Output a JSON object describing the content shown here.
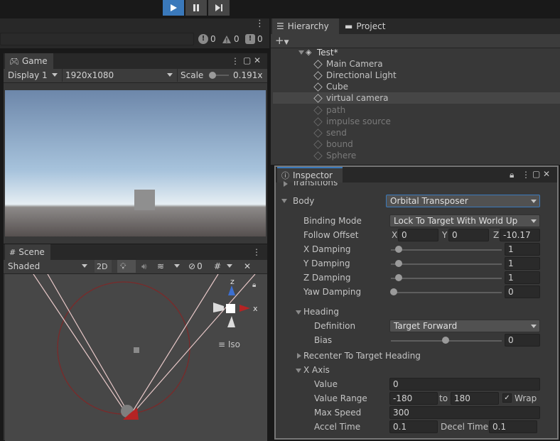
{
  "toolbar": {
    "play_icon": "play-icon",
    "pause_icon": "pause-icon",
    "step_icon": "step-icon"
  },
  "console": {
    "error_count": "0",
    "warning_count": "0",
    "info_count": "0"
  },
  "game": {
    "tab_label": "Game",
    "display": "Display 1",
    "resolution": "1920x1080",
    "scale_label": "Scale",
    "scale_value": "0.191x"
  },
  "scene": {
    "tab_label": "Scene",
    "shading": "Shaded",
    "mode_2d": "2D",
    "hidden_count": "0",
    "gizmo_axis_z": "z",
    "gizmo_axis_x": "x",
    "projection": "Iso"
  },
  "hierarchy": {
    "tab_label": "Hierarchy",
    "project_tab_label": "Project",
    "add_label": "+",
    "scene_name": "Test*",
    "items": [
      {
        "label": "Main Camera",
        "active": true
      },
      {
        "label": "Directional Light",
        "active": true
      },
      {
        "label": "Cube",
        "active": true
      },
      {
        "label": "virtual camera",
        "active": true,
        "selected": true
      },
      {
        "label": "path",
        "active": false
      },
      {
        "label": "impulse source",
        "active": false
      },
      {
        "label": "send",
        "active": false
      },
      {
        "label": "bound",
        "active": false
      },
      {
        "label": "Sphere",
        "active": false
      }
    ]
  },
  "inspector": {
    "tab_label": "Inspector",
    "transitions_label": "Transitions",
    "body_label": "Body",
    "body_value": "Orbital Transposer",
    "binding_mode_label": "Binding Mode",
    "binding_mode_value": "Lock To Target With World Up",
    "follow_offset_label": "Follow Offset",
    "follow_offset": {
      "x_label": "X",
      "x": "0",
      "y_label": "Y",
      "y": "0",
      "z_label": "Z",
      "z": "-10.17"
    },
    "x_damping_label": "X Damping",
    "x_damping": "1",
    "y_damping_label": "Y Damping",
    "y_damping": "1",
    "z_damping_label": "Z Damping",
    "z_damping": "1",
    "yaw_damping_label": "Yaw Damping",
    "yaw_damping": "0",
    "heading_label": "Heading",
    "definition_label": "Definition",
    "definition_value": "Target Forward",
    "bias_label": "Bias",
    "bias_value": "0",
    "recenter_label": "Recenter To Target Heading",
    "x_axis_label": "X Axis",
    "value_label": "Value",
    "value": "0",
    "value_range_label": "Value Range",
    "range_min": "-180",
    "range_to": "to",
    "range_max": "180",
    "wrap_label": "Wrap",
    "max_speed_label": "Max Speed",
    "max_speed": "300",
    "accel_time_label": "Accel Time",
    "accel_time": "0.1",
    "decel_time_label": "Decel Time",
    "decel_time": "0.1"
  },
  "colors": {
    "accent": "#3a79bb",
    "background": "#383838",
    "field": "#2a2a2a",
    "gizmo_red": "#b52424",
    "gizmo_blue": "#3c6fd1"
  }
}
